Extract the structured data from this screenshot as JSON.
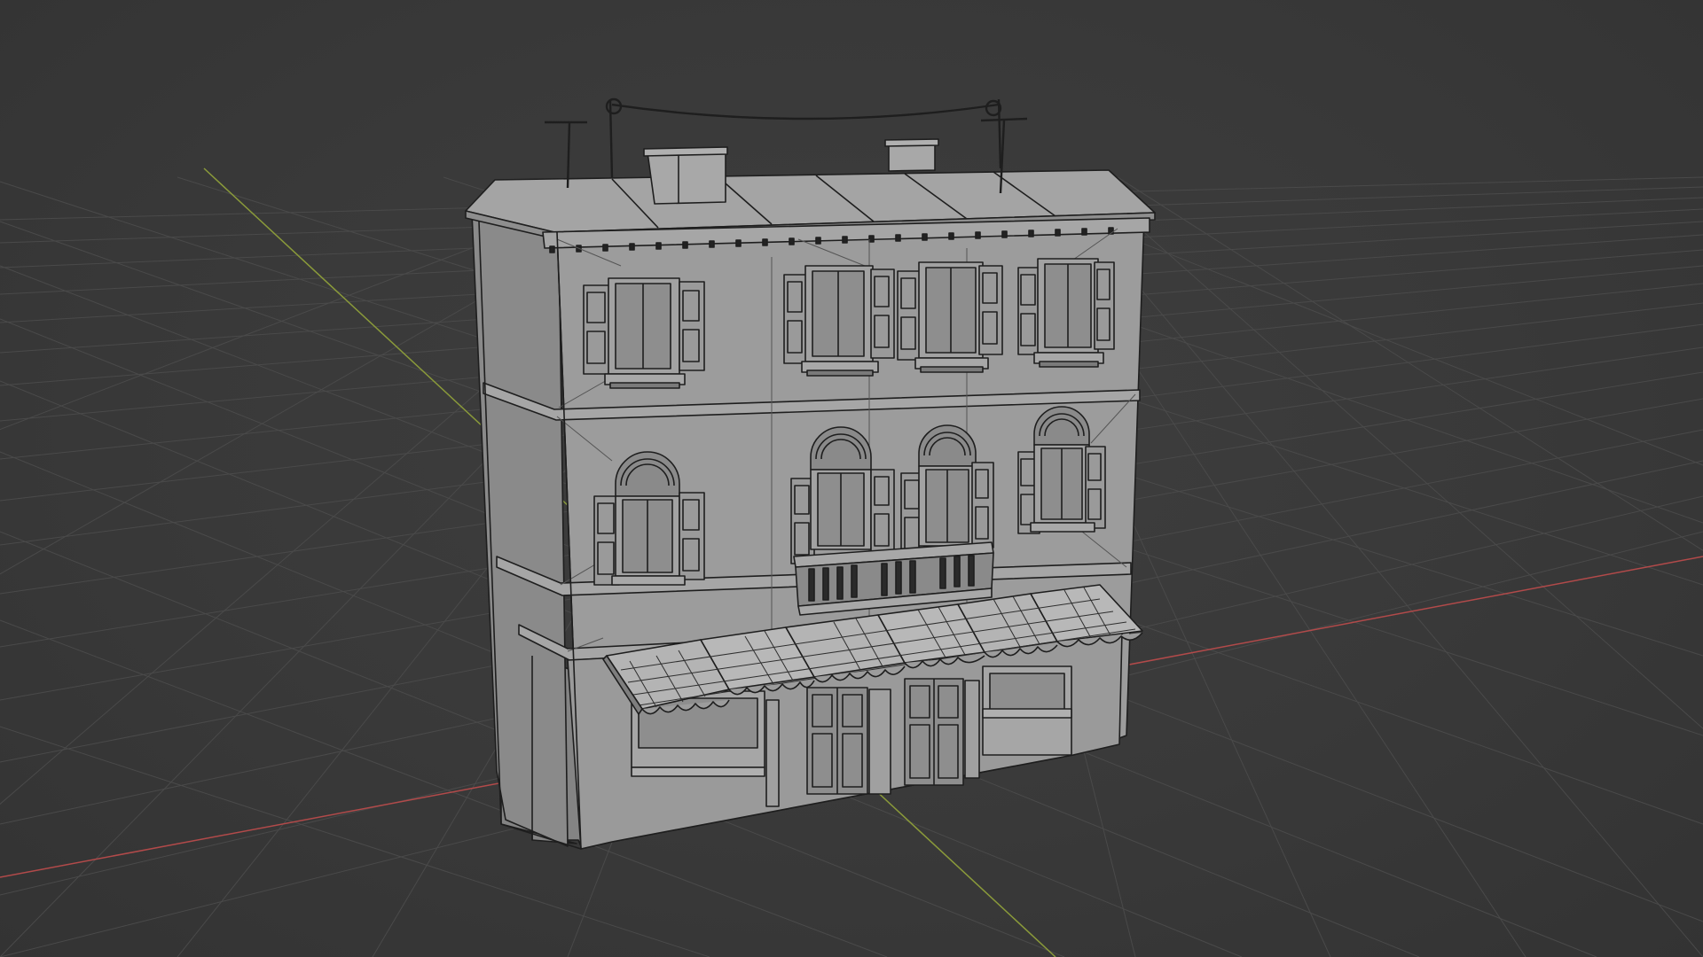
{
  "app": {
    "view": "3D Viewport",
    "shading": "solid-wireframe"
  },
  "scene": {
    "object": "building",
    "background_color": "#3a3a3a",
    "grid_color": "#4a4a4a",
    "x_axis_color": "#b24a4a",
    "y_axis_color": "#8a9a3a",
    "wall_color": "#9a9a9a",
    "wall_shadow_color": "#848484",
    "roof_color": "#a2a2a2",
    "wire_color": "#1e1e1e"
  }
}
